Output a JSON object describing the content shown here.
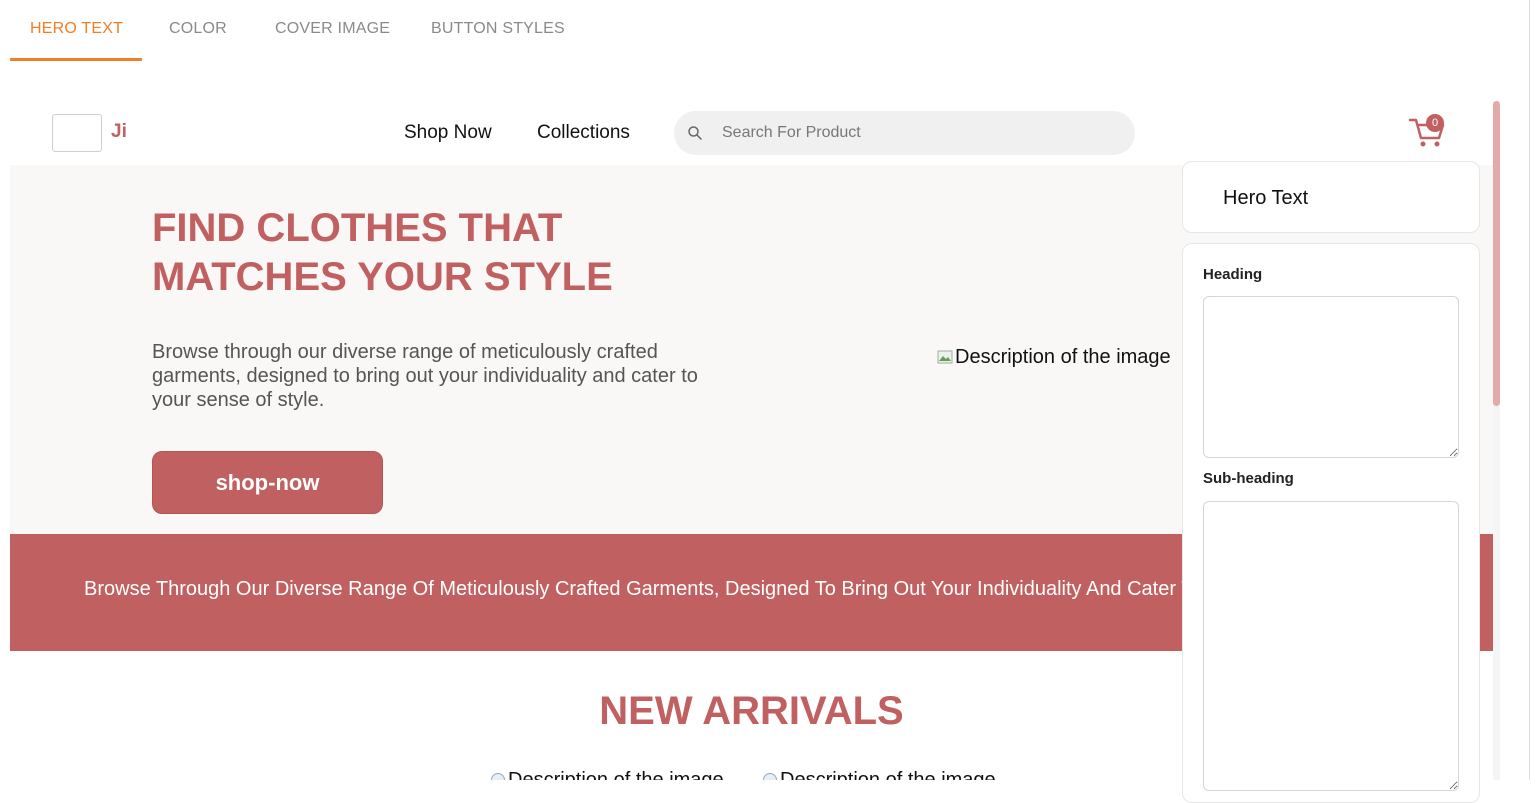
{
  "editor_tabs": [
    {
      "label": "HERO TEXT",
      "active": true
    },
    {
      "label": "COLOR",
      "active": false
    },
    {
      "label": "COVER IMAGE",
      "active": false
    },
    {
      "label": "BUTTON STYLES",
      "active": false
    }
  ],
  "navbar": {
    "logo_text": "Ji",
    "links": [
      "Shop Now",
      "Collections"
    ],
    "search_placeholder": "Search For Product",
    "cart_count": "0"
  },
  "hero": {
    "title": "FIND CLOTHES THAT MATCHES YOUR STYLE",
    "subtitle": "Browse through our diverse range of meticulously crafted garments, designed to bring out your individuality and cater to your sense of style.",
    "button_label": "shop-now",
    "image_alt": "Description of the image"
  },
  "banner": {
    "text": "Browse Through Our Diverse Range Of Meticulously Crafted Garments, Designed To Bring Out Your Individuality And Cater To Your Sense Of Style."
  },
  "arrivals": {
    "title": "NEW ARRIVALS",
    "image_alts": [
      "Description of the image",
      "Description of the image"
    ]
  },
  "panel": {
    "title": "Hero Text",
    "heading_label": "Heading",
    "heading_value": "",
    "subheading_label": "Sub-heading",
    "subheading_value": ""
  },
  "colors": {
    "accent": "#f07e26",
    "brand": "#c06060",
    "hero_bg": "#faf8f7"
  }
}
